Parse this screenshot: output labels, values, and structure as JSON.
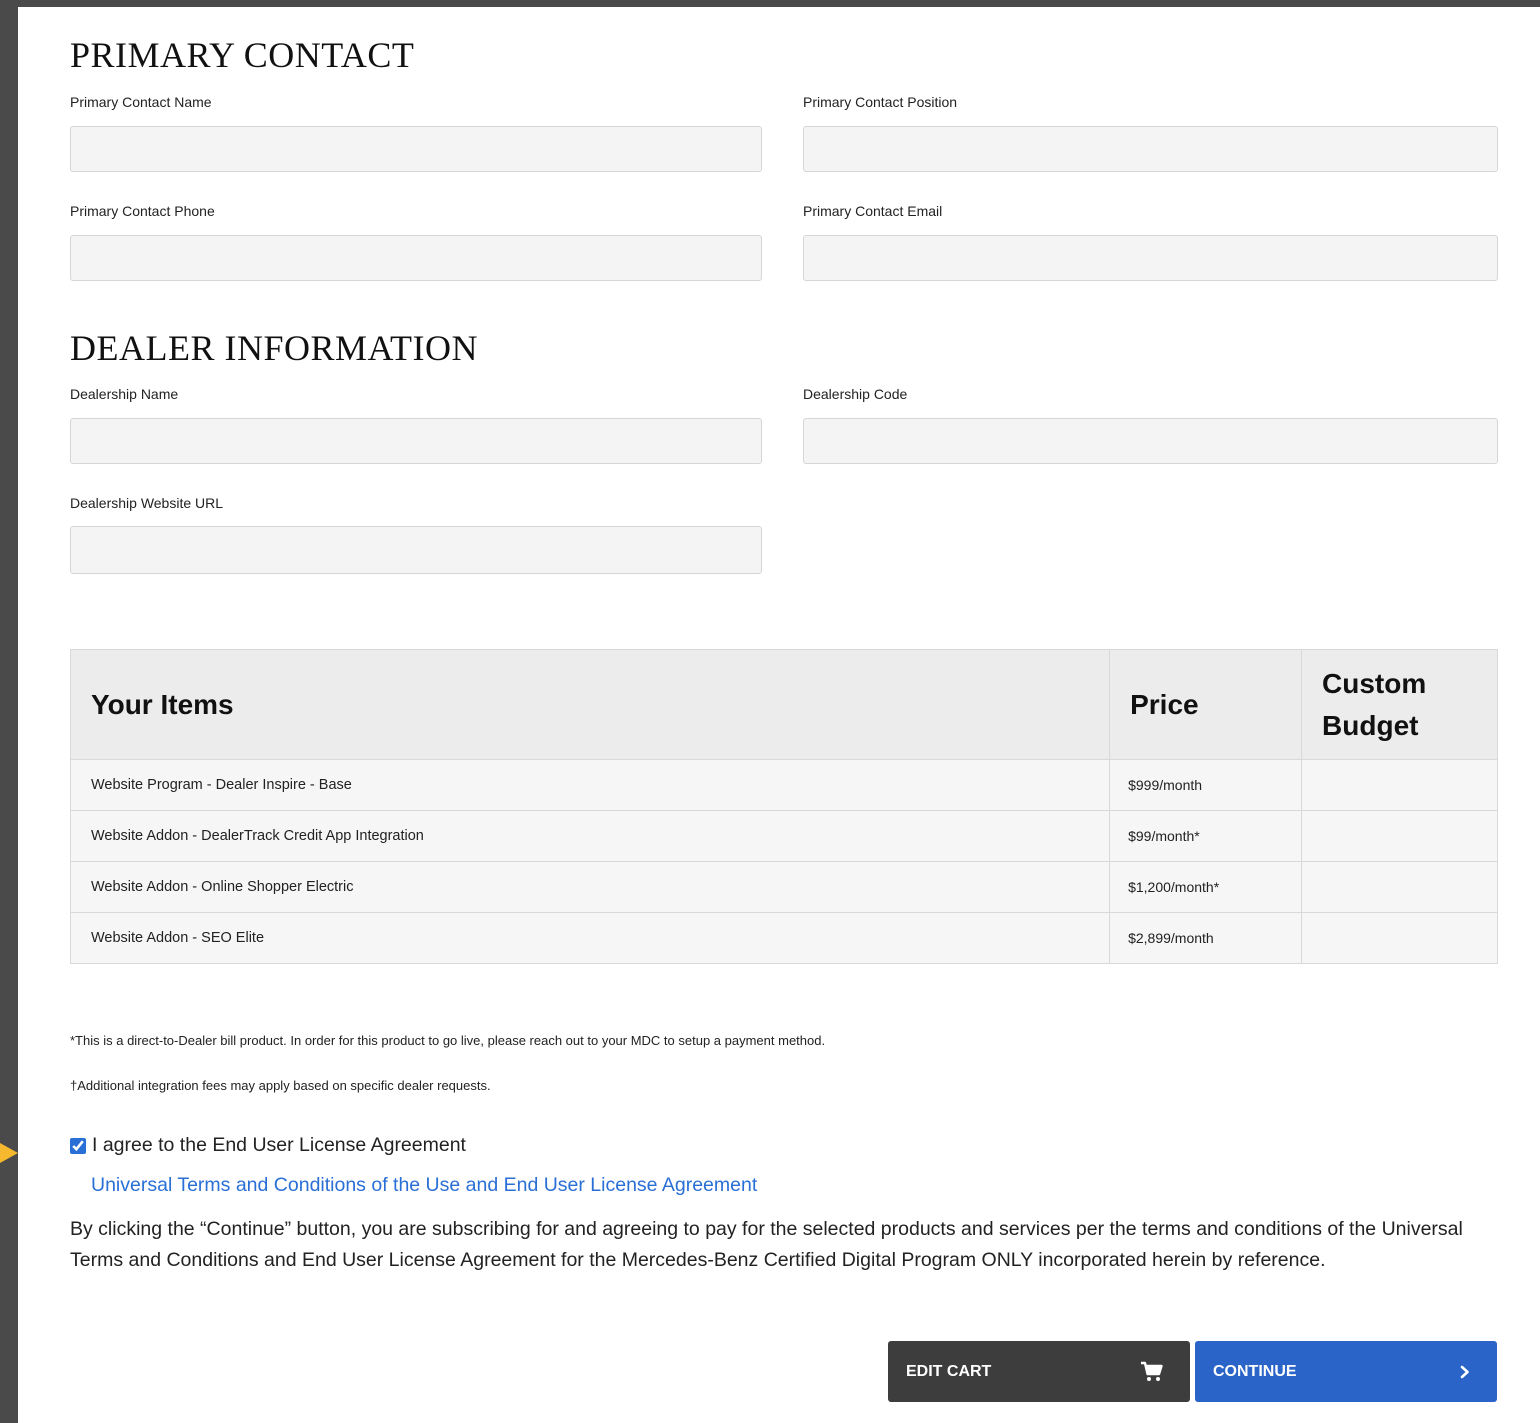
{
  "primary_contact": {
    "title": "PRIMARY CONTACT",
    "name_label": "Primary Contact Name",
    "position_label": "Primary Contact Position",
    "phone_label": "Primary Contact Phone",
    "email_label": "Primary Contact Email",
    "name_value": "",
    "position_value": "",
    "phone_value": "",
    "email_value": ""
  },
  "dealer_info": {
    "title": "DEALER INFORMATION",
    "dealership_name_label": "Dealership Name",
    "dealership_code_label": "Dealership Code",
    "website_url_label": "Dealership Website URL",
    "dealership_name_value": "",
    "dealership_code_value": "",
    "website_url_value": ""
  },
  "items_table": {
    "headers": [
      "Your Items",
      "Price",
      "Custom Budget"
    ],
    "rows": [
      {
        "item": "Website Program - Dealer Inspire - Base",
        "price": "$999/month",
        "budget": ""
      },
      {
        "item": "Website Addon - DealerTrack Credit App Integration",
        "price": "$99/month*",
        "budget": ""
      },
      {
        "item": "Website Addon - Online Shopper Electric",
        "price": "$1,200/month*",
        "budget": ""
      },
      {
        "item": "Website Addon - SEO Elite",
        "price": "$2,899/month",
        "budget": ""
      }
    ]
  },
  "notes": {
    "direct_bill": "*This is a direct-to-Dealer bill product. In order for this product to go live, please reach out to your MDC to setup a payment method.",
    "integration_fees": "†Additional integration fees may apply based on specific dealer requests."
  },
  "agreement": {
    "checkbox_label": "I agree to the End User License Agreement",
    "checked": true,
    "terms_link": "Universal Terms and Conditions of the Use and End User License Agreement",
    "disclaimer": "By clicking the “Continue” button, you are subscribing for and agreeing to pay for the selected products and services per the terms and conditions of the Universal Terms and Conditions and End User License Agreement for the Mercedes-Benz Certified Digital Program ONLY incorporated herein by reference."
  },
  "buttons": {
    "edit_cart": "EDIT CART",
    "continue": "CONTINUE"
  },
  "icons": {
    "edit_cart": "cart-icon",
    "continue": "chevron-right-icon"
  },
  "colors": {
    "link": "#2a6fd6",
    "continue_button": "#2a64c8",
    "edit_cart_button": "#3d3d3d",
    "rail_arrow": "#f5b82e"
  }
}
